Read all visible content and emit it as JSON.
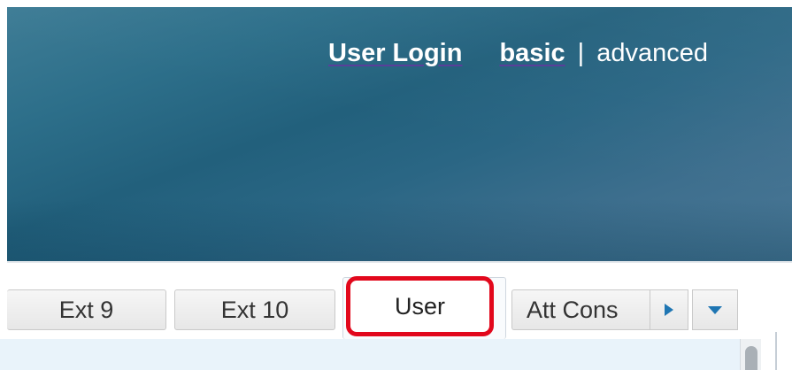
{
  "header": {
    "links": {
      "user_login": "User Login",
      "basic": "basic",
      "separator": "|",
      "advanced": "advanced"
    }
  },
  "tabs": {
    "items": [
      {
        "label": "Ext 9"
      },
      {
        "label": "Ext 10"
      },
      {
        "label": "User",
        "active": true,
        "highlighted": true
      },
      {
        "label": "Att Cons"
      }
    ],
    "scroll_right_icon": "triangle-right-icon",
    "menu_icon": "triangle-down-icon"
  },
  "colors": {
    "header_blue": "#2d6f8a",
    "highlight_red": "#e2081c",
    "icon_blue": "#1f76b3",
    "underline_purple": "#5a3f9a"
  }
}
